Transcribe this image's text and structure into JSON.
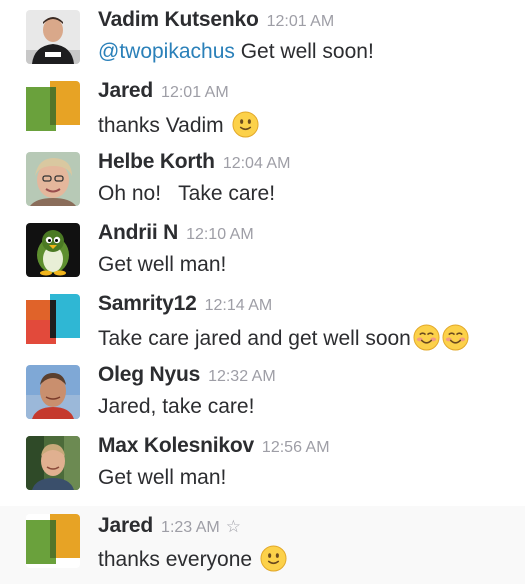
{
  "messages": [
    {
      "author": "Vadim Kutsenko",
      "time": "12:01 AM",
      "mention": "@twopikachus",
      "text": " Get well soon!",
      "avatar": "photo-vadim-icon"
    },
    {
      "author": "Jared",
      "time": "12:01 AM",
      "text": "thanks Vadim ",
      "emoji": "slightly-smiling-icon",
      "avatar": "colorful-squares-icon"
    },
    {
      "author": "Helbe Korth",
      "time": "12:04 AM",
      "text": "Oh no!   Take care!",
      "avatar": "photo-helbe-icon"
    },
    {
      "author": "Andrii N",
      "time": "12:10 AM",
      "text": "Get well man!",
      "avatar": "penguin-icon"
    },
    {
      "author": "Samrity12",
      "time": "12:14 AM",
      "text": "Take care jared and get well soon",
      "emoji": "smiling-blush-icon",
      "avatar": "colorful-squares-icon"
    },
    {
      "author": "Oleg Nyus",
      "time": "12:32 AM",
      "text": "Jared, take care!",
      "avatar": "photo-oleg-icon"
    },
    {
      "author": "Max Kolesnikov",
      "time": "12:56 AM",
      "text": "Get well man!",
      "avatar": "photo-max-icon"
    },
    {
      "author": "Jared",
      "time": "1:23 AM",
      "text": "thanks everyone ",
      "emoji": "slightly-smiling-icon",
      "avatar": "colorful-squares-icon",
      "star": "☆"
    }
  ],
  "colors": {
    "mention": "#2a80b9",
    "timestamp": "#9e9ea6",
    "hover_background": "#f9f9f9"
  }
}
